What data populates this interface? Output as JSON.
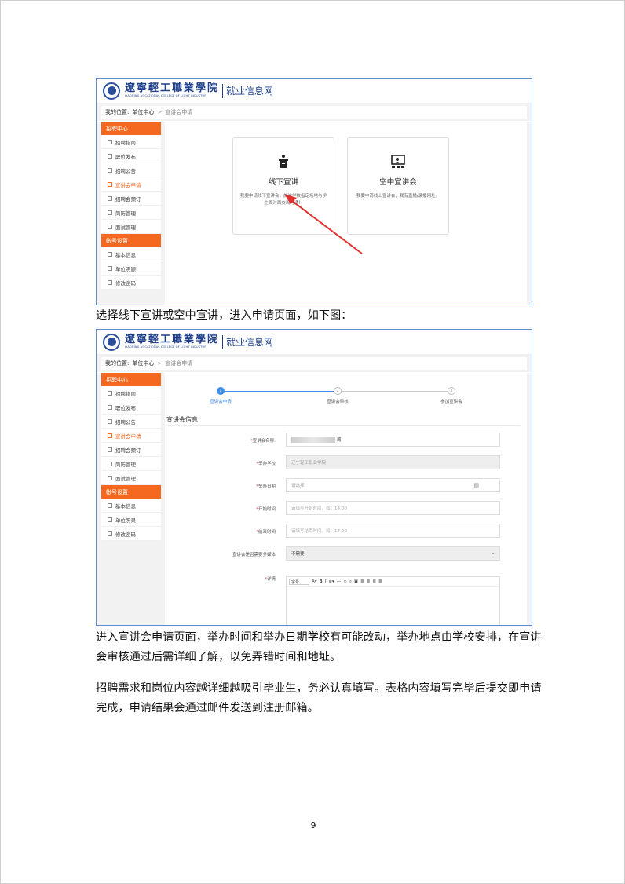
{
  "header": {
    "logo_cn": "遼寧輕工職業學院",
    "logo_en": "LIAONING VOCATIONAL COLLEGE OF LIGHT INDUSTRY",
    "site_name": "就业信息网"
  },
  "breadcrumb": {
    "prefix": "我的位置:",
    "unit": "单位中心",
    "separator": ">",
    "current": "宣讲会申请"
  },
  "sidebar": {
    "group1": "招聘中心",
    "items1": [
      "招聘指南",
      "职位发布",
      "招聘公告",
      "宣讲会申请",
      "招聘会预订",
      "简历管理",
      "面试管理"
    ],
    "group2": "帐号设置",
    "items2": [
      "基本信息",
      "单位照顾",
      "修改密码"
    ],
    "items2b": [
      "基本信息",
      "单位照录",
      "修改密码"
    ]
  },
  "cards": {
    "offline_title": "线下宣讲",
    "offline_desc": "我要申请线下宣讲会，前往学校指定场地与学生面对面交流沟通！",
    "online_title": "空中宣讲会",
    "online_desc": "我要申请线上宣讲会，我有直播/录播网址。"
  },
  "paragraphs": {
    "p1": "选择线下宣讲或空中宣讲，进入申请页面，如下图：",
    "p2": "进入宣讲会申请页面，举办时间和举办日期学校有可能改动，举办地点由学校安排，在宣讲会审核通过后需详细了解，以免弄错时间和地址。",
    "p3": "招聘需求和岗位内容越详细越吸引毕业生，务必认真填写。表格内容填写完毕后提交即申请完成，申请结果会通过邮件发送到注册邮箱。"
  },
  "steps": [
    "宣讲会申请",
    "宣讲会审核",
    "参加宣讲会"
  ],
  "form": {
    "section_title": "宣讲会信息",
    "name_label": "宣讲会名称",
    "name_suffix": "湾",
    "school_label": "举办学校",
    "school_value": "辽宁轻工职业学院",
    "date_label": "举办日期",
    "date_placeholder": "请选择",
    "start_label": "开始时间",
    "start_placeholder": "请填写开始时间，如：14:00",
    "end_label": "结束时间",
    "end_placeholder": "请填写结束时间，如：17:00",
    "media_label": "宣讲会是否需要多媒体",
    "media_value": "不需要",
    "detail_label": "详情",
    "toolbar_font": "字号"
  },
  "page_number": "9",
  "colors": {
    "accent_orange": "#f4681f",
    "brand_blue": "#1f3f8a",
    "step_blue": "#3c8ee8",
    "frame_border": "#5b8fd0",
    "arrow_red": "#e0302e"
  }
}
